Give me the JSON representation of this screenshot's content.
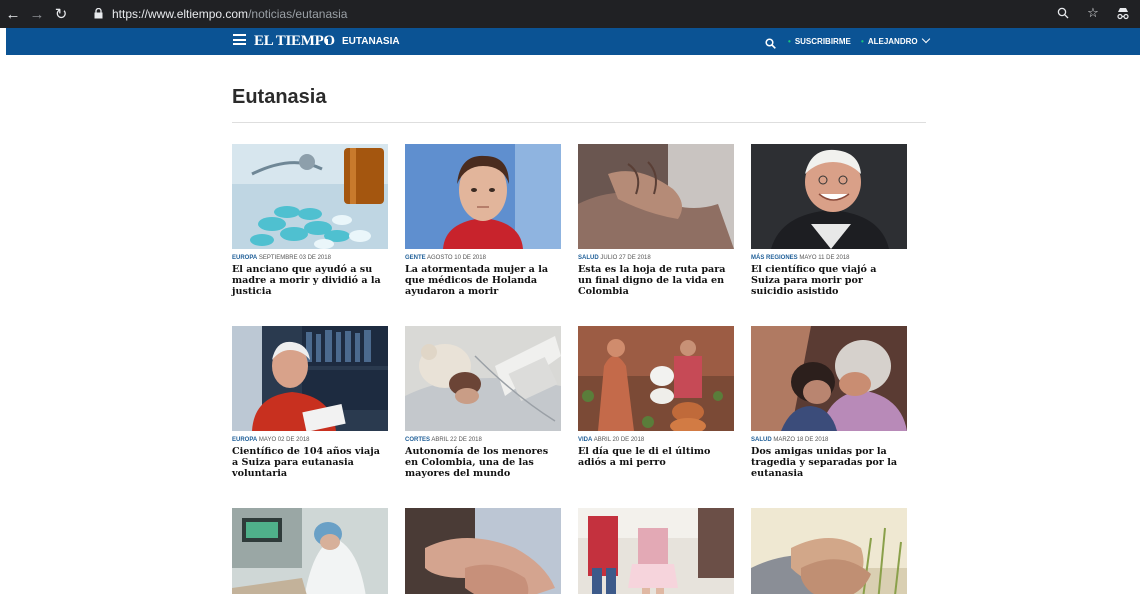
{
  "browser": {
    "url_domain": "https://www.eltiempo.com",
    "url_path": "/noticias/eutanasia",
    "back_icon": "back-arrow-icon",
    "forward_icon": "forward-arrow-icon",
    "reload_icon": "reload-icon"
  },
  "header": {
    "logo": "EL TIEMPO",
    "section": "EUTANASIA",
    "subscribe": "SUSCRIBIRME",
    "user": "ALEJANDRO",
    "accent": "#0b5394"
  },
  "page": {
    "title": "Eutanasia"
  },
  "articles": [
    {
      "category": "EUROPA",
      "date": "SEPTIEMBRE 03 DE 2018",
      "headline": "El anciano que ayudó a su madre a morir y dividió a la justicia"
    },
    {
      "category": "GENTE",
      "date": "AGOSTO 10 DE 2018",
      "headline": "La atormentada mujer a la que médicos de Holanda ayudaron a morir"
    },
    {
      "category": "SALUD",
      "date": "JULIO 27 DE 2018",
      "headline": "Esta es la hoja de ruta para un final digno de la vida en Colombia"
    },
    {
      "category": "MÁS REGIONES",
      "date": "MAYO 11 DE 2018",
      "headline": "El científico que viajó a Suiza para morir por suicidio asistido"
    },
    {
      "category": "EUROPA",
      "date": "MAYO 02 DE 2018",
      "headline": "Científico de 104 años viaja a Suiza para eutanasia voluntaria"
    },
    {
      "category": "CORTES",
      "date": "ABRIL 22 DE 2018",
      "headline": "Autonomía de los menores en Colombia, una de las mayores del mundo"
    },
    {
      "category": "VIDA",
      "date": "ABRIL 20 DE 2018",
      "headline": "El día que le di el último adiós a mi perro"
    },
    {
      "category": "SALUD",
      "date": "MARZO 18 DE 2018",
      "headline": "Dos amigas unidas por la tragedia y separadas por la eutanasia"
    }
  ]
}
